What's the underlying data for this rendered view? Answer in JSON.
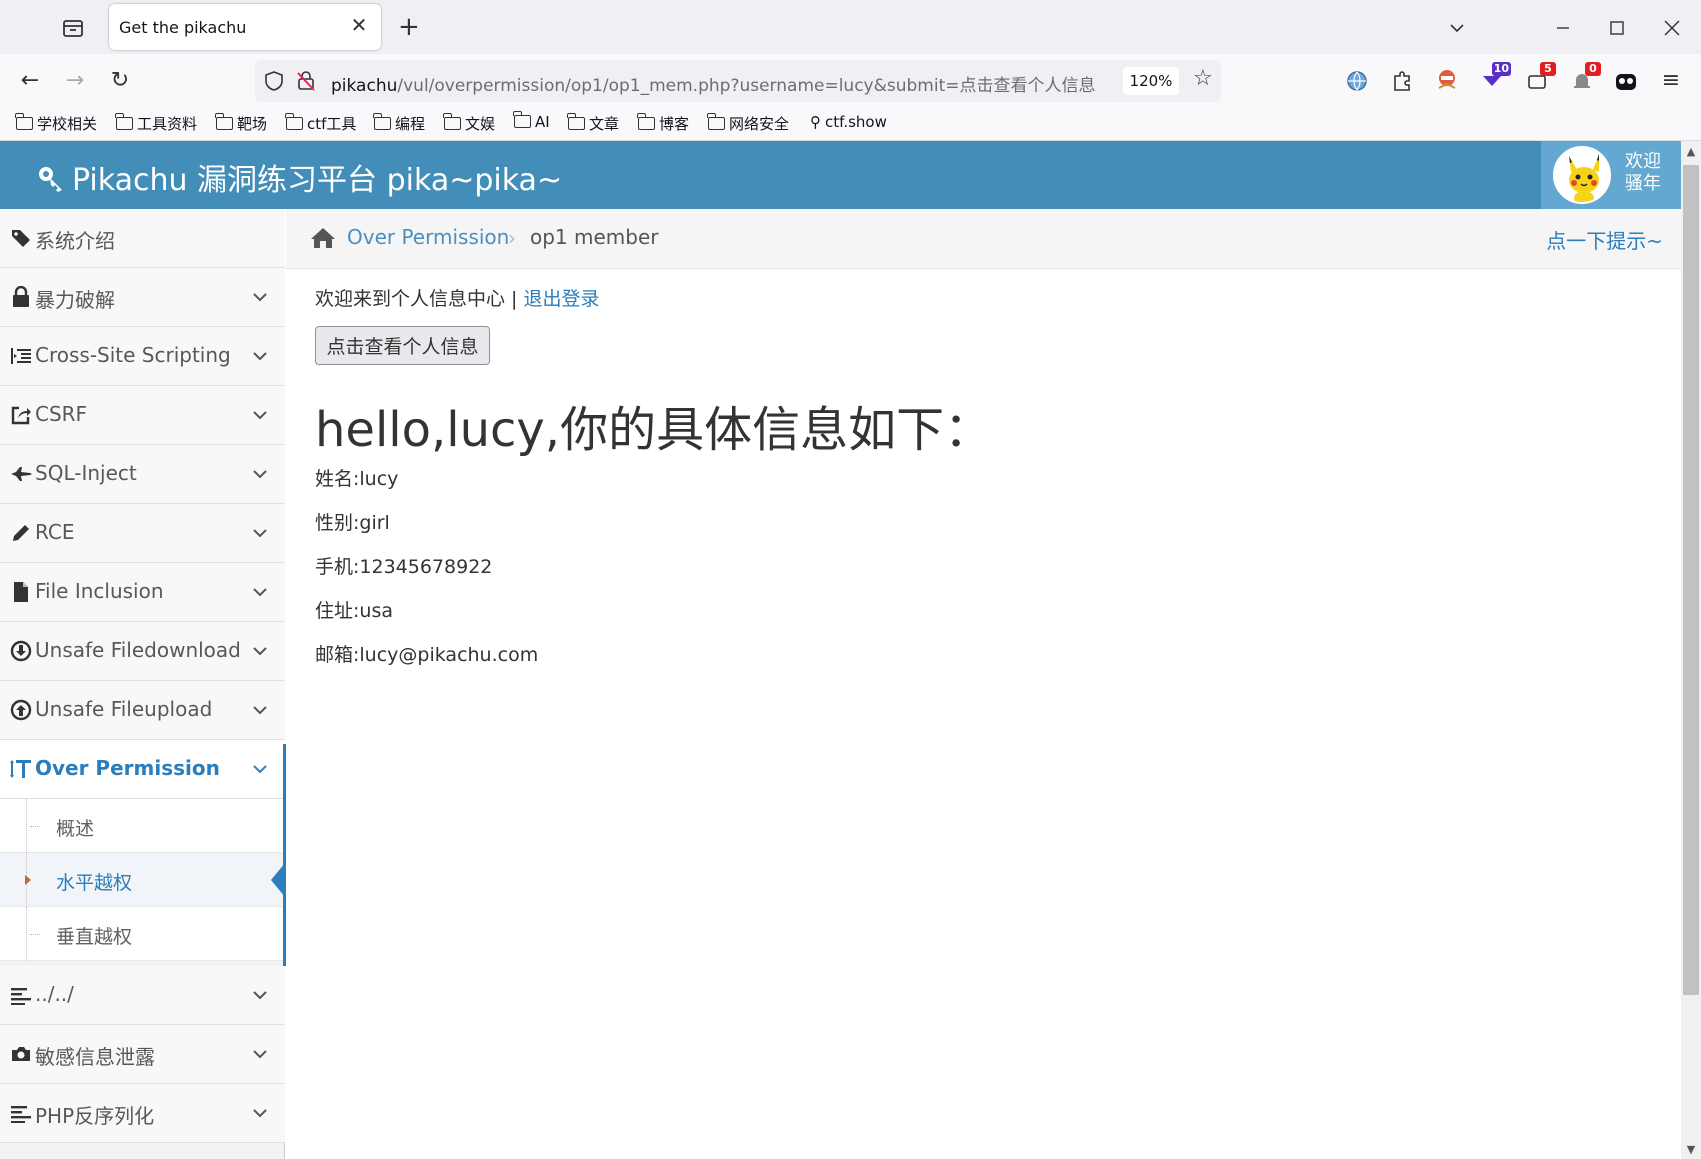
{
  "browser": {
    "tab_title": "Get the pikachu",
    "url_host": "pikachu",
    "url_path": "/vul/overpermission/op1/op1_mem.php?username=lucy&submit=点击查看个人信息",
    "zoom": "120%",
    "badges": {
      "ublock": "10",
      "ext_red1": "5",
      "ext_red2": "0"
    },
    "bookmarks": [
      "学校相关",
      "工具资料",
      "靶场",
      "ctf工具",
      "编程",
      "文娱",
      "AI",
      "文章",
      "博客",
      "网络安全",
      "ctf.show"
    ]
  },
  "header": {
    "brand": "Pikachu 漏洞练习平台 pika~pika~",
    "welcome_line1": "欢迎",
    "welcome_line2": "骚年"
  },
  "sidebar": {
    "items": [
      {
        "label": "系统介绍",
        "icon": "tags-icon"
      },
      {
        "label": "暴力破解",
        "icon": "lock-icon"
      },
      {
        "label": "Cross-Site Scripting",
        "icon": "list-indent-icon"
      },
      {
        "label": "CSRF",
        "icon": "share-square-icon"
      },
      {
        "label": "SQL-Inject",
        "icon": "fighter-jet-icon"
      },
      {
        "label": "RCE",
        "icon": "pencil-icon"
      },
      {
        "label": "File Inclusion",
        "icon": "file-icon"
      },
      {
        "label": "Unsafe Filedownload",
        "icon": "download-circle-icon"
      },
      {
        "label": "Unsafe Fileupload",
        "icon": "upload-circle-icon"
      },
      {
        "label": "Over Permission",
        "icon": "text-height-icon"
      },
      {
        "label": "../../",
        "icon": "align-left-icon"
      },
      {
        "label": "敏感信息泄露",
        "icon": "camera-icon"
      },
      {
        "label": "PHP反序列化",
        "icon": "align-left-icon"
      }
    ],
    "sub_items": [
      "概述",
      "水平越权",
      "垂直越权"
    ]
  },
  "breadcrumb": {
    "parent": "Over Permission",
    "current": "op1 member",
    "hint": "点一下提示~"
  },
  "main": {
    "welcome": "欢迎来到个人信息中心 | ",
    "logout": "退出登录",
    "view_button": "点击查看个人信息",
    "heading": "hello,lucy,你的具体信息如下：",
    "fields": [
      "姓名:lucy",
      "性别:girl",
      "手机:12345678922",
      "住址:usa",
      "邮箱:lucy@pikachu.com"
    ]
  },
  "colors": {
    "header_bg": "#438eb9",
    "accent": "#2b7dbc"
  }
}
